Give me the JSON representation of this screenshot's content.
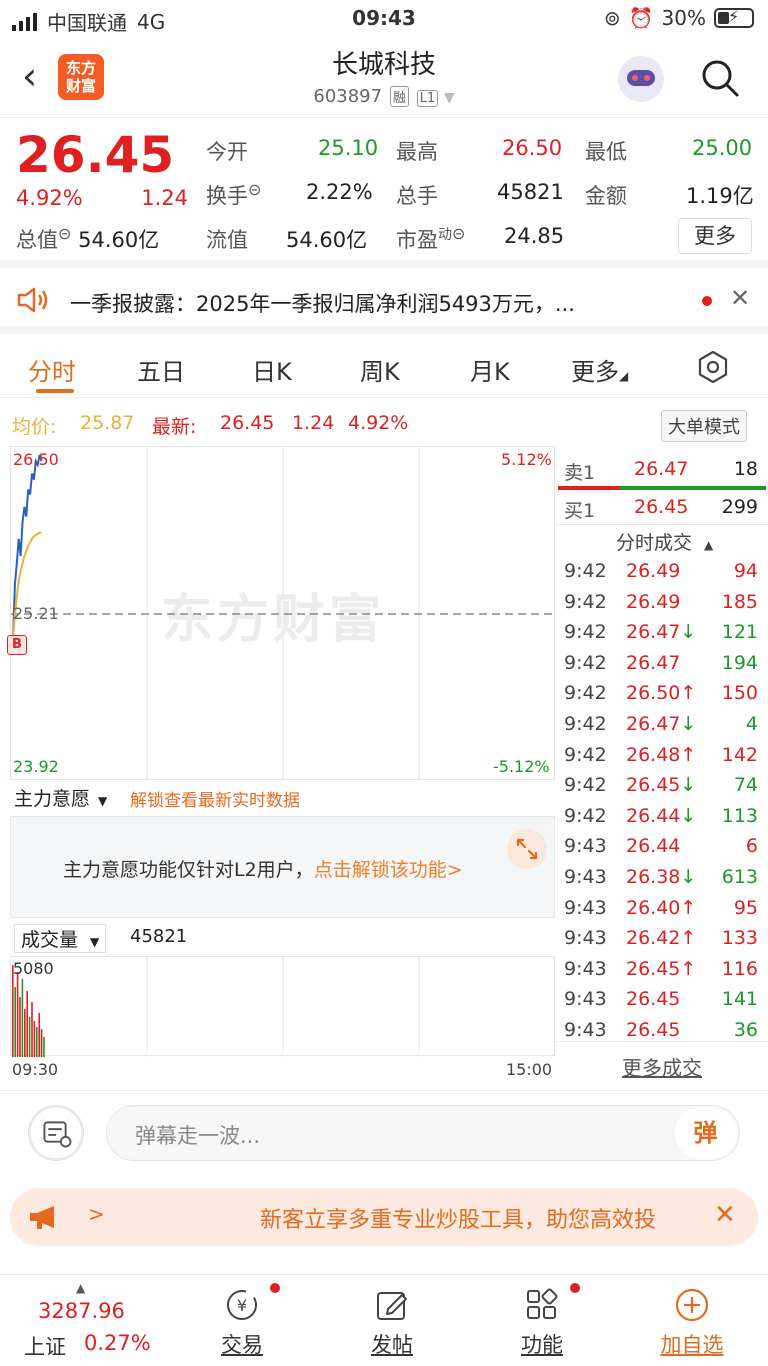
{
  "status": {
    "carrier": "中国联通",
    "network": "4G",
    "time": "09:43",
    "battery": "30%"
  },
  "header": {
    "logo_line1": "东方",
    "logo_line2": "财富",
    "title": "长城科技",
    "code": "603897",
    "tag1": "融",
    "tag2": "L1"
  },
  "quote": {
    "price": "26.45",
    "pct": "4.92%",
    "change": "1.24",
    "open_label": "今开",
    "open": "25.10",
    "high_label": "最高",
    "high": "26.50",
    "low_label": "最低",
    "low": "25.00",
    "turnover_label": "换手",
    "turnover": "2.22%",
    "volume_label": "总手",
    "volume": "45821",
    "amount_label": "金额",
    "amount": "1.19亿",
    "total_mv_label": "总值",
    "total_mv": "54.60亿",
    "float_mv_label": "流值",
    "float_mv": "54.60亿",
    "pe_label": "市盈",
    "pe_sup": "动",
    "pe": "24.85",
    "more": "更多"
  },
  "notice": {
    "text": "一季报披露：2025年一季报归属净利润5493万元，..."
  },
  "tabs": [
    "分时",
    "五日",
    "日K",
    "周K",
    "月K",
    "更多"
  ],
  "info": {
    "avg_label": "均价:",
    "avg": "25.87",
    "last_label": "最新:",
    "last": "26.45",
    "chg": "1.24",
    "pct": "4.92%",
    "mode": "大单模式"
  },
  "chart": {
    "y_top": "26.50",
    "y_mid": "25.21",
    "y_bot": "23.92",
    "pct_top": "5.12%",
    "pct_bot": "-5.12%",
    "watermark": "东方财富",
    "marker": "B",
    "x_start": "09:30",
    "x_end": "15:00"
  },
  "chart_data": {
    "type": "line",
    "series": [
      {
        "name": "price",
        "values": [
          25.0,
          25.45,
          25.62,
          25.82,
          25.68,
          25.95,
          26.08,
          26.0,
          26.22,
          26.18,
          26.35,
          26.3,
          26.45,
          26.42,
          26.5,
          26.45
        ]
      },
      {
        "name": "avg",
        "values": [
          25.0,
          25.2,
          25.35,
          25.48,
          25.55,
          25.62,
          25.68,
          25.72,
          25.76,
          25.79,
          25.82,
          25.84,
          25.85,
          25.86,
          25.87,
          25.87
        ]
      }
    ],
    "ylim": [
      23.92,
      26.5
    ],
    "prev_close": 25.21
  },
  "book": {
    "sell_label": "卖1",
    "sell_price": "26.47",
    "sell_qty": "18",
    "buy_label": "买1",
    "buy_price": "26.45",
    "buy_qty": "299",
    "trades_title": "分时成交",
    "more_trades": "更多成交",
    "trades": [
      {
        "t": "9:42",
        "p": "26.49",
        "q": "94",
        "arrow": "",
        "pc": "red",
        "qc": "red"
      },
      {
        "t": "9:42",
        "p": "26.49",
        "q": "185",
        "arrow": "",
        "pc": "red",
        "qc": "red"
      },
      {
        "t": "9:42",
        "p": "26.47",
        "q": "121",
        "arrow": "↓",
        "pc": "red",
        "qc": "green"
      },
      {
        "t": "9:42",
        "p": "26.47",
        "q": "194",
        "arrow": "",
        "pc": "red",
        "qc": "green"
      },
      {
        "t": "9:42",
        "p": "26.50",
        "q": "150",
        "arrow": "↑",
        "pc": "red",
        "qc": "red"
      },
      {
        "t": "9:42",
        "p": "26.47",
        "q": "4",
        "arrow": "↓",
        "pc": "red",
        "qc": "green"
      },
      {
        "t": "9:42",
        "p": "26.48",
        "q": "142",
        "arrow": "↑",
        "pc": "red",
        "qc": "red"
      },
      {
        "t": "9:42",
        "p": "26.45",
        "q": "74",
        "arrow": "↓",
        "pc": "red",
        "qc": "green"
      },
      {
        "t": "9:42",
        "p": "26.44",
        "q": "113",
        "arrow": "↓",
        "pc": "red",
        "qc": "green"
      },
      {
        "t": "9:43",
        "p": "26.44",
        "q": "6",
        "arrow": "",
        "pc": "red",
        "qc": "red"
      },
      {
        "t": "9:43",
        "p": "26.38",
        "q": "613",
        "arrow": "↓",
        "pc": "red",
        "qc": "green"
      },
      {
        "t": "9:43",
        "p": "26.40",
        "q": "95",
        "arrow": "↑",
        "pc": "red",
        "qc": "red"
      },
      {
        "t": "9:43",
        "p": "26.42",
        "q": "133",
        "arrow": "↑",
        "pc": "red",
        "qc": "red"
      },
      {
        "t": "9:43",
        "p": "26.45",
        "q": "116",
        "arrow": "↑",
        "pc": "red",
        "qc": "red"
      },
      {
        "t": "9:43",
        "p": "26.45",
        "q": "141",
        "arrow": "",
        "pc": "red",
        "qc": "green"
      },
      {
        "t": "9:43",
        "p": "26.45",
        "q": "36",
        "arrow": "",
        "pc": "red",
        "qc": "green"
      }
    ]
  },
  "mainforce": {
    "selector": "主力意愿",
    "unlock": "解锁查看最新实时数据",
    "msg_prefix": "主力意愿功能仅针对L2用户，",
    "msg_link": "点击解锁该功能>"
  },
  "volume": {
    "selector": "成交量",
    "value": "45821",
    "axis_top": "5080"
  },
  "danmu": {
    "placeholder": "弹幕走一波...",
    "send": "弹"
  },
  "promo": {
    "arrow": ">",
    "text": "新客立享多重专业炒股工具，助您高效投"
  },
  "nav": {
    "index_value": "3287.96",
    "index_name": "上证",
    "index_pct": "0.27%",
    "items": [
      "交易",
      "发帖",
      "功能",
      "加自选"
    ]
  }
}
